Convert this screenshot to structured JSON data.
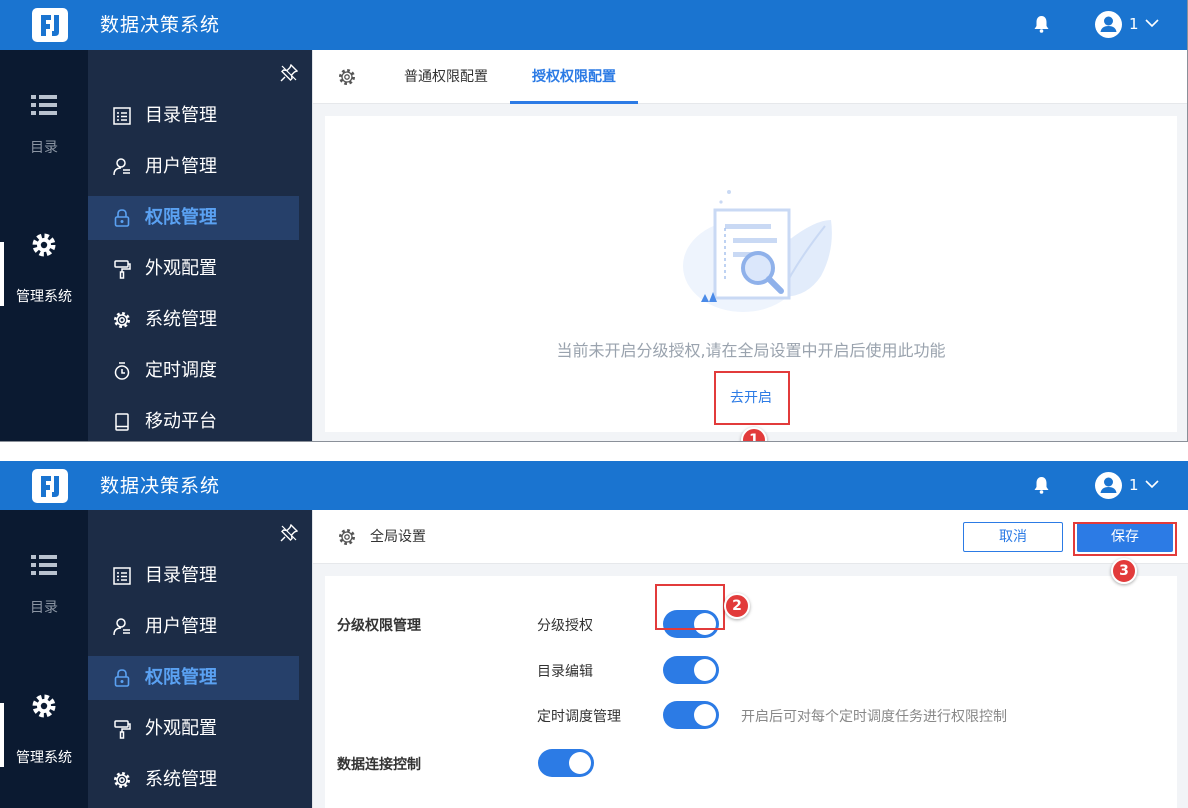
{
  "app": {
    "title": "数据决策系统",
    "user_name": "1"
  },
  "rail": {
    "items": [
      {
        "label": "目录",
        "icon": "list-icon",
        "active": false
      },
      {
        "label": "管理系统",
        "icon": "gear-icon",
        "active": true
      }
    ]
  },
  "menu": {
    "items": [
      {
        "label": "目录管理",
        "icon": "directory-icon"
      },
      {
        "label": "用户管理",
        "icon": "user-icon"
      },
      {
        "label": "权限管理",
        "icon": "lock-icon",
        "active": true
      },
      {
        "label": "外观配置",
        "icon": "paint-roller-icon"
      },
      {
        "label": "系统管理",
        "icon": "gear-icon"
      },
      {
        "label": "定时调度",
        "icon": "timer-icon"
      },
      {
        "label": "移动平台",
        "icon": "mobile-icon"
      }
    ]
  },
  "panel1": {
    "tabs": [
      {
        "label": "普通权限配置",
        "active": false
      },
      {
        "label": "授权权限配置",
        "active": true
      }
    ],
    "empty_message": "当前未开启分级授权,请在全局设置中开启后使用此功能",
    "enable_link": "去开启",
    "badge": "1"
  },
  "panel2": {
    "header_title": "全局设置",
    "cancel_label": "取消",
    "save_label": "保存",
    "sections": [
      {
        "label": "分级权限管理",
        "options": [
          {
            "label": "分级授权",
            "enabled": true
          },
          {
            "label": "目录编辑",
            "enabled": true
          },
          {
            "label": "定时调度管理",
            "enabled": true,
            "hint": "开启后可对每个定时调度任务进行权限控制"
          }
        ]
      },
      {
        "label": "数据连接控制",
        "enabled": true
      }
    ],
    "badges": [
      "2",
      "3"
    ]
  },
  "colors": {
    "brand": "#1a74d0",
    "accent": "#2c7be5",
    "sidebar": "#1c2c46",
    "rail": "#0b1a31",
    "highlight": "#e23b3b"
  }
}
